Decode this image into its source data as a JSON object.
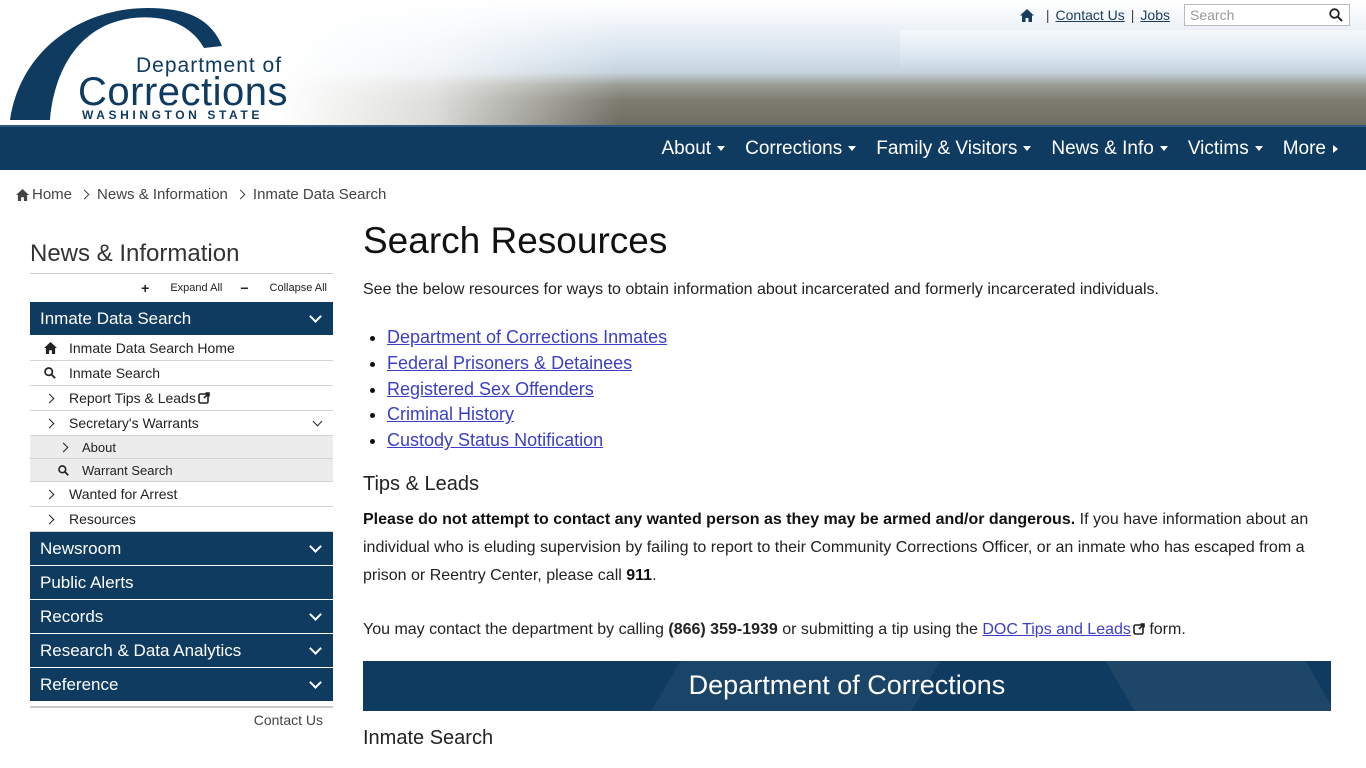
{
  "header": {
    "logo": {
      "line1": "Department of",
      "line2": "Corrections",
      "line3": "WASHINGTON STATE"
    },
    "util": {
      "contact_label": "Contact Us",
      "jobs_label": "Jobs",
      "search_placeholder": "Search",
      "separator": "|"
    }
  },
  "nav": {
    "items": [
      {
        "label": "About"
      },
      {
        "label": "Corrections"
      },
      {
        "label": "Family & Visitors"
      },
      {
        "label": "News & Info"
      },
      {
        "label": "Victims"
      },
      {
        "label": "More"
      }
    ]
  },
  "breadcrumb": {
    "items": [
      "Home",
      "News & Information",
      "Inmate Data Search"
    ]
  },
  "sidebar": {
    "title": "News & Information",
    "expand_all": "Expand All",
    "collapse_all": "Collapse All",
    "sections": [
      {
        "label": "Inmate Data Search"
      },
      {
        "label": "Newsroom"
      },
      {
        "label": "Public Alerts"
      },
      {
        "label": "Records"
      },
      {
        "label": "Research & Data Analytics"
      },
      {
        "label": "Reference"
      }
    ],
    "items": [
      {
        "label": "Inmate Data Search Home"
      },
      {
        "label": "Inmate Search"
      },
      {
        "label": "Report Tips & Leads"
      },
      {
        "label": "Secretary's Warrants"
      },
      {
        "label": "About"
      },
      {
        "label": "Warrant Search"
      },
      {
        "label": "Wanted for Arrest"
      },
      {
        "label": "Resources"
      }
    ],
    "contact": "Contact Us"
  },
  "main": {
    "title": "Search Resources",
    "intro": "See the below resources for ways to obtain information about incarcerated and formerly incarcerated individuals.",
    "links": [
      "Department of Corrections Inmates",
      "Federal Prisoners & Detainees",
      "Registered Sex Offenders",
      "Criminal History",
      "Custody Status Notification"
    ],
    "tips_heading": "Tips & Leads",
    "warning_bold": "Please do not attempt to contact any wanted person as they may be armed and/or dangerous.",
    "warning_text": " If you have information about an individual who is eluding supervision by failing to report to their Community Corrections Officer, or an inmate who has escaped from a prison or Reentry Center, please call ",
    "phone_911": "911",
    "warning_end": ".",
    "contact_pre": "You may contact the department by calling ",
    "contact_phone": "(866) 359-1939",
    "contact_mid": " or submitting a tip using the ",
    "contact_link": "DOC Tips and Leads",
    "contact_post": " form.",
    "banner": "Department of Corrections",
    "subheading": "Inmate Search"
  },
  "colors": {
    "navy": "#0f3b60",
    "link": "#3b3fc6"
  }
}
